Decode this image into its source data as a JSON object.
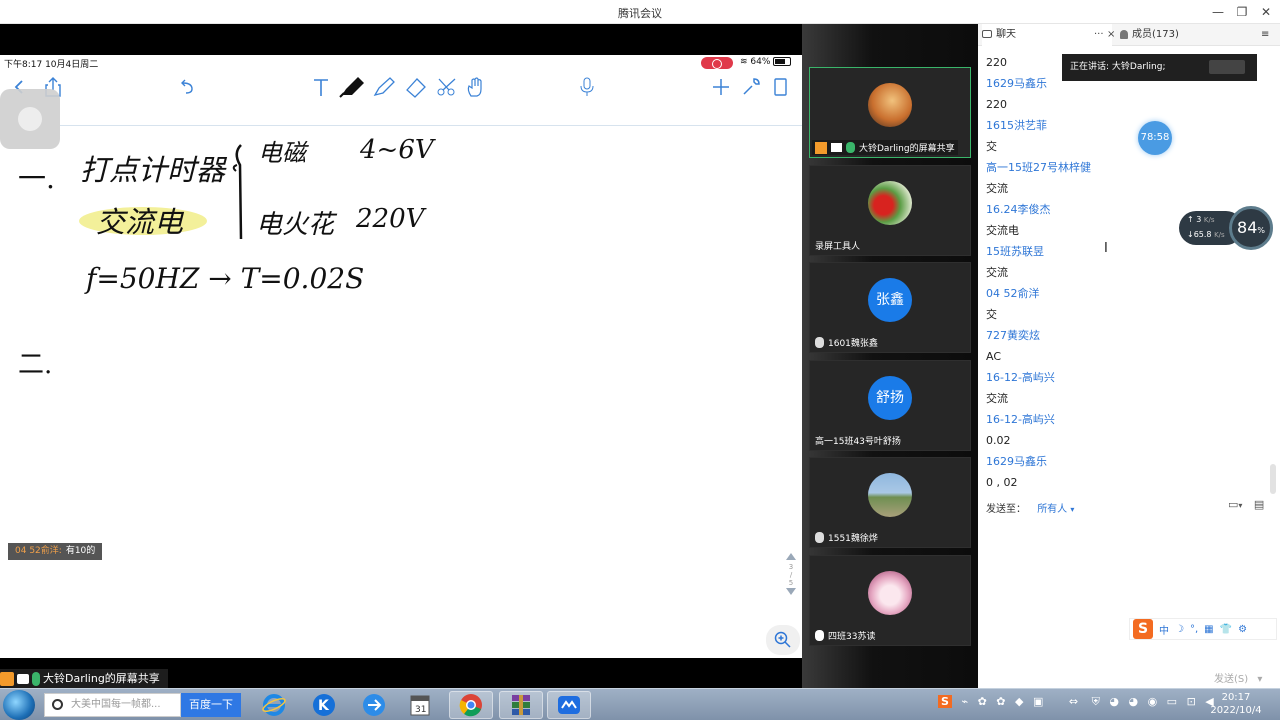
{
  "window": {
    "title": "腾讯会议",
    "buttons": [
      "—",
      "❐",
      "✕"
    ]
  },
  "ipad": {
    "status_time": "下午8:17  10月4日周二",
    "battery": "64%",
    "page_indicator": [
      "3",
      "/",
      "5"
    ],
    "handwriting": {
      "line1_a": "一.",
      "line1_b": "打点计时器",
      "line1_c": "电磁",
      "line1_d": "4~6V",
      "line2_a": "交流电",
      "line2_b": "电火花",
      "line2_c": "220V",
      "line3": "f=50HZ → T=0.02S",
      "line4": "二."
    }
  },
  "chat_popup": {
    "sender": "04 52俞洋:",
    "text": "有10的"
  },
  "share_label": "大铃Darling的屏幕共享",
  "participants": [
    {
      "name": "大铃Darling的屏幕共享",
      "avatar": "photo-sunset",
      "active": true
    },
    {
      "name": "录屏工具人",
      "avatar": "photo-strawberry",
      "active": false
    },
    {
      "name": "1601魏张鑫",
      "avatar_text": "张鑫",
      "active": false
    },
    {
      "name": "高一15班43号叶舒扬",
      "avatar_text": "舒扬",
      "active": false
    },
    {
      "name": "1551魏徐烨",
      "avatar": "photo-landscape",
      "active": false
    },
    {
      "name": "四班33苏读",
      "avatar": "photo-anime",
      "active": false
    }
  ],
  "chat": {
    "tab_chat": "聊天",
    "tab_members": "成员(173)",
    "speaking": "正在讲话: 大铃Darling;",
    "timer": "78:58",
    "net_up": "3",
    "net_down": "65.8",
    "net_unit": "K/s",
    "cpu": "84",
    "cpu_unit": "%",
    "messages": [
      {
        "type": "text",
        "value": "220"
      },
      {
        "type": "name",
        "value": "1629马鑫乐"
      },
      {
        "type": "text",
        "value": "220"
      },
      {
        "type": "name",
        "value": "1615洪艺菲"
      },
      {
        "type": "text",
        "value": "交"
      },
      {
        "type": "name",
        "value": "高一15班27号林梓健"
      },
      {
        "type": "text",
        "value": "交流"
      },
      {
        "type": "name",
        "value": "16.24李俊杰"
      },
      {
        "type": "text",
        "value": "交流电"
      },
      {
        "type": "name",
        "value": "15班苏联昱"
      },
      {
        "type": "text",
        "value": "交流"
      },
      {
        "type": "name",
        "value": "04 52俞洋"
      },
      {
        "type": "text",
        "value": "交"
      },
      {
        "type": "name",
        "value": "727黄奕炫"
      },
      {
        "type": "text",
        "value": "AC"
      },
      {
        "type": "name",
        "value": "16-12-高屿兴"
      },
      {
        "type": "text",
        "value": "交流"
      },
      {
        "type": "name",
        "value": "16-12-高屿兴"
      },
      {
        "type": "text",
        "value": "0.02"
      },
      {
        "type": "name",
        "value": "1629马鑫乐"
      },
      {
        "type": "text",
        "value": "0 , 02"
      }
    ],
    "send_to_label": "发送至：",
    "send_to_value": "所有人",
    "send_button": "发送(S)",
    "ime": "中"
  },
  "taskbar": {
    "search_placeholder": "大美中国每一帧都...",
    "search_button": "百度一下",
    "time": "20:17",
    "date": "2022/10/4"
  }
}
